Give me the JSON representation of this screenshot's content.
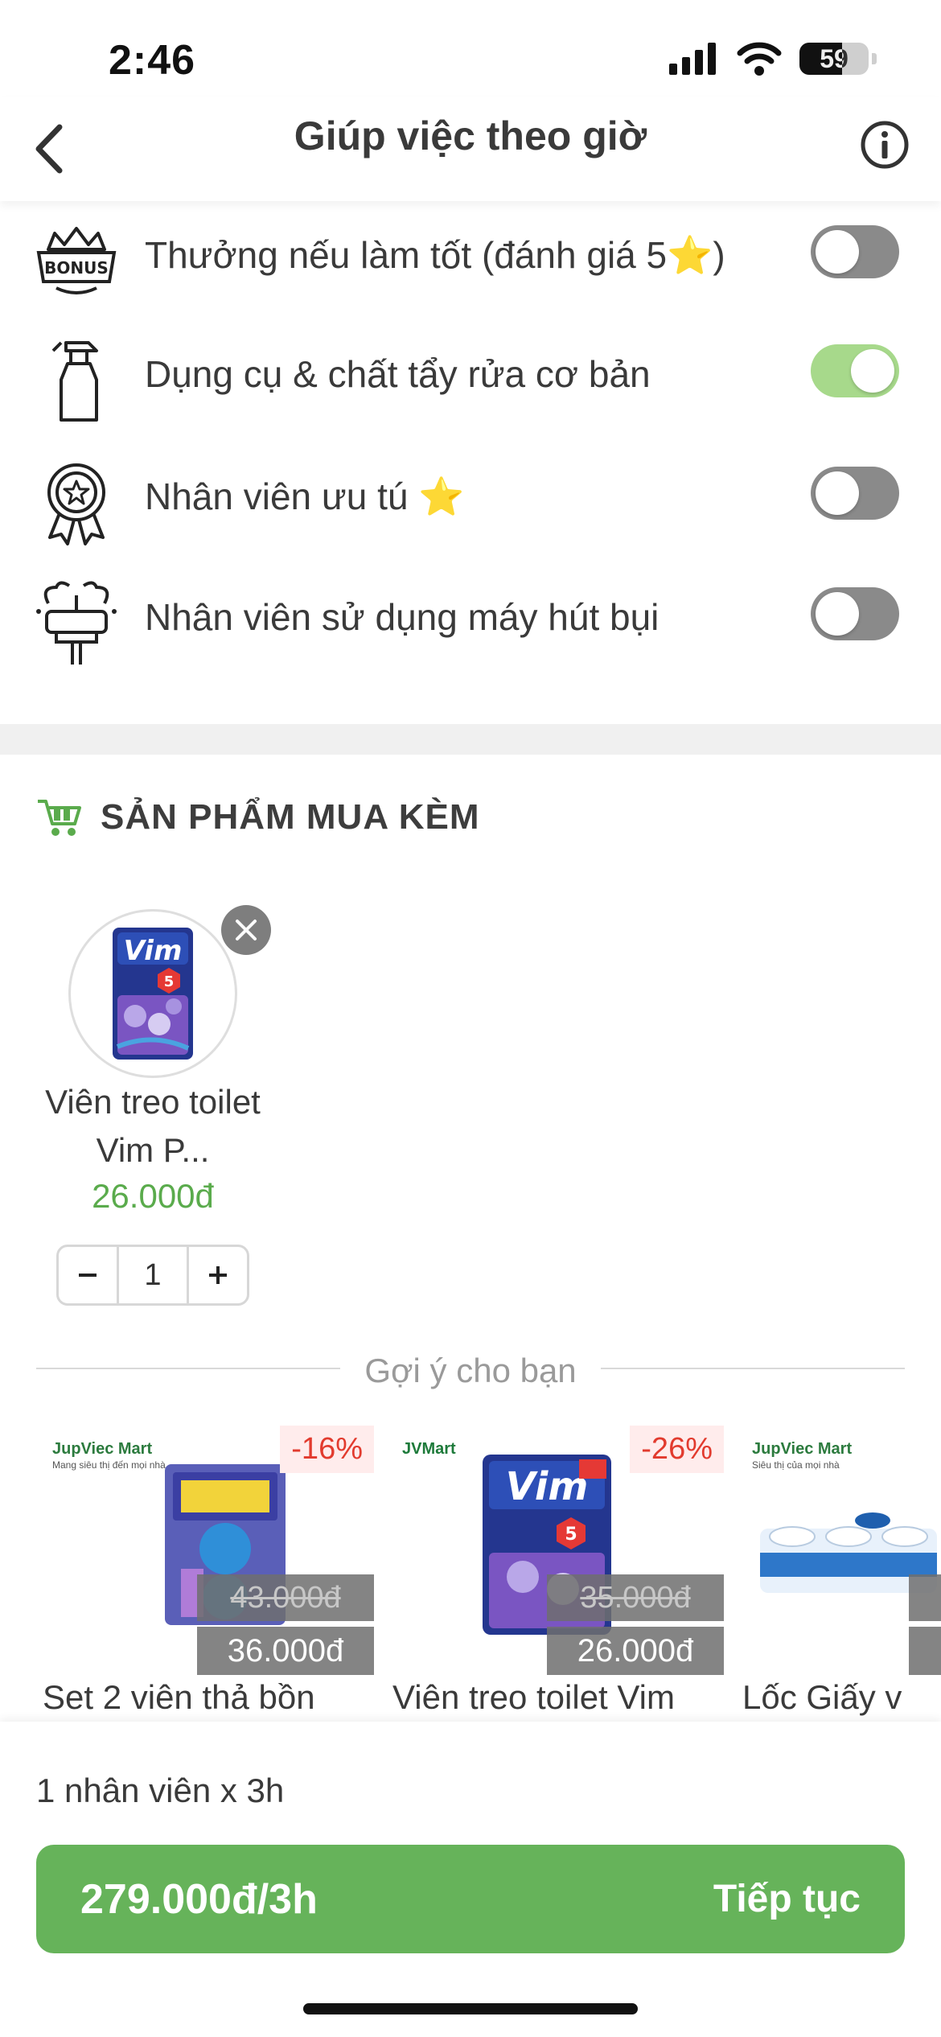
{
  "status_bar": {
    "time": "2:46",
    "battery": "59"
  },
  "header": {
    "title": "Giúp việc theo giờ"
  },
  "options": [
    {
      "label": "Thưởng nếu làm tốt (đánh giá 5⭐)",
      "icon": "bonus-icon",
      "enabled": false
    },
    {
      "label": "Dụng cụ & chất tẩy rửa cơ bản",
      "icon": "spray-bottle-icon",
      "enabled": true
    },
    {
      "label": "Nhân viên ưu tú ⭐",
      "icon": "medal-icon",
      "enabled": false
    },
    {
      "label": "Nhân viên sử dụng máy hút bụi",
      "icon": "vacuum-cleaner-icon",
      "enabled": false
    }
  ],
  "bought_with": {
    "title": "SẢN PHẨM MUA KÈM",
    "items": [
      {
        "name": "Viên treo toilet Vim P...",
        "price": "26.000đ",
        "quantity": "1"
      }
    ]
  },
  "suggestions": {
    "label": "Gợi ý cho bạn",
    "products": [
      {
        "name": "Set 2 viên thả bồn",
        "brand": "JupViec Mart",
        "brand_sub": "Mang siêu thị đến mọi nhà",
        "discount": "-16%",
        "old_price": "43.000đ",
        "new_price": "36.000đ"
      },
      {
        "name": "Viên treo toilet Vim",
        "brand": "JVMart",
        "brand_sub": "",
        "discount": "-26%",
        "old_price": "35.000đ",
        "new_price": "26.000đ"
      },
      {
        "name": "Lốc Giấy v",
        "brand": "JupViec Mart",
        "brand_sub": "Siêu thị của mọi nhà",
        "discount": "",
        "old_price": "",
        "new_price": ""
      }
    ]
  },
  "bottom": {
    "summary": "1 nhân viên x 3h",
    "price": "279.000đ/3h",
    "continue_label": "Tiếp tục"
  },
  "colors": {
    "accent": "#66b35a",
    "price_green": "#5aab4c",
    "discount_red": "#e23b2e"
  }
}
